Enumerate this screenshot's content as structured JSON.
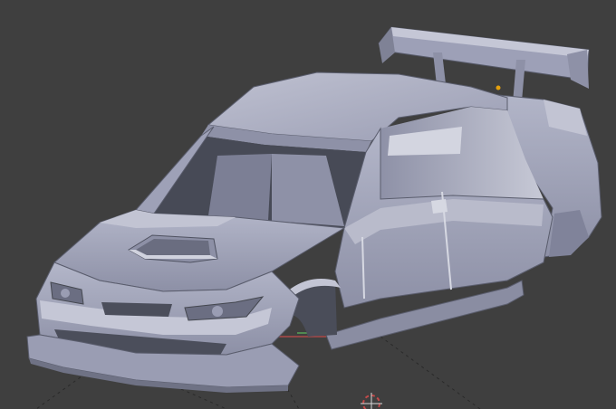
{
  "viewport": {
    "background": "#3f3f3f",
    "model_color": "#a3a6bd",
    "model_shadow": "#6f7285",
    "model_highlight": "#d2d3de",
    "grid_color": "#2a2a2a",
    "x_axis_color": "#c24a4a",
    "y_axis_color": "#5cb85c",
    "selection_dot_color": "#e5a00d",
    "cursor_color": "#d9d9d9",
    "cursor_ring_color": "#c24a4a"
  },
  "icons": {
    "cursor": "3d-cursor-icon",
    "origin": "object-origin-icon"
  }
}
